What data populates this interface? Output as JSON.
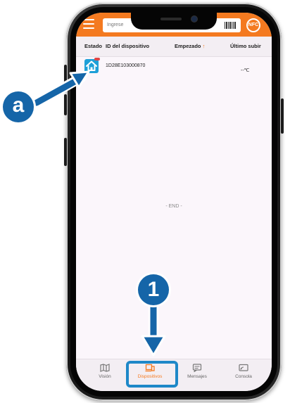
{
  "header": {
    "search_placeholder": "Ingrese",
    "nfc_label": "NFC"
  },
  "columns": {
    "estado": "Estado",
    "device_id": "ID del dispositivo",
    "started": "Empezado",
    "sort_glyph": "↑",
    "last_upload": "Último subir"
  },
  "device": {
    "id": "1D28E103000870",
    "temperature": "--℃",
    "icon": "home-icon"
  },
  "list_end": "- END -",
  "bottom_nav": {
    "vision": "Visión",
    "devices": "Dispositivos",
    "messages": "Mensajes",
    "console": "Consola"
  },
  "annotations": {
    "marker_a": "a",
    "marker_1": "1"
  },
  "colors": {
    "brand_orange": "#f47a20",
    "annotation_blue": "#1565a8",
    "highlight_blue": "#1e88c8",
    "device_tile": "#1ea0d8"
  }
}
